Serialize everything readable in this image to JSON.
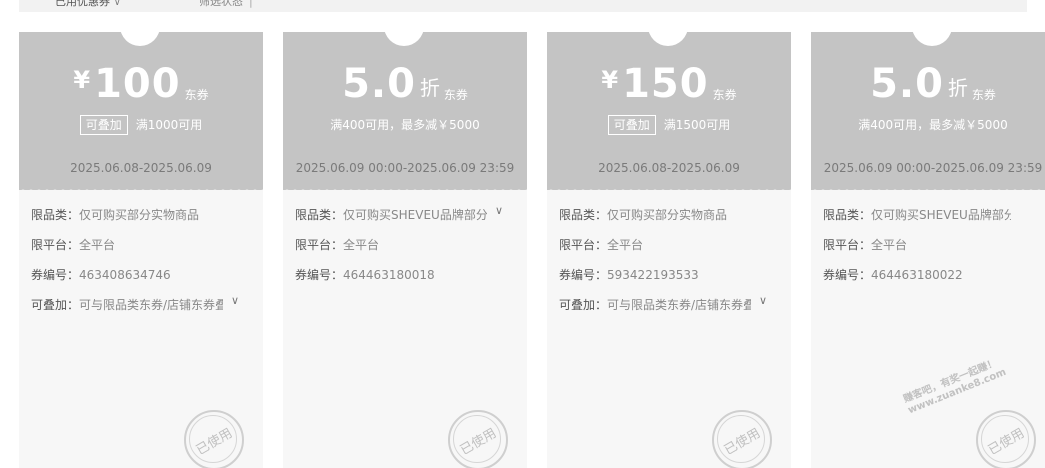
{
  "filters": {
    "coupon_type": "已用优惠券",
    "status": "筛选状态"
  },
  "coupons": [
    {
      "currency": "¥",
      "amount": "100",
      "discount_suffix": "",
      "unit": "东券",
      "stack_badge": "可叠加",
      "condition": "满1000可用",
      "dates": "2025.06.08-2025.06.09",
      "rows": [
        {
          "label": "限品类：",
          "text": "仅可购买部分实物商品"
        },
        {
          "label": "限平台：",
          "text": "全平台"
        },
        {
          "label": "券编号：",
          "text": "463408634746"
        },
        {
          "label": "可叠加：",
          "text": "可与限品类东券/店铺东券叠加"
        }
      ],
      "used": "已使用"
    },
    {
      "currency": "",
      "amount": "5.0",
      "discount_suffix": "折",
      "unit": "东券",
      "stack_badge": "",
      "condition": "满400可用，最多减￥5000",
      "dates": "2025.06.09 00:00-2025.06.09 23:59",
      "rows": [
        {
          "label": "限品类：",
          "text": "仅可购买SHEVEU品牌部分商品"
        },
        {
          "label": "限平台：",
          "text": "全平台"
        },
        {
          "label": "券编号：",
          "text": "464463180018"
        }
      ],
      "used": "已使用"
    },
    {
      "currency": "¥",
      "amount": "150",
      "discount_suffix": "",
      "unit": "东券",
      "stack_badge": "可叠加",
      "condition": "满1500可用",
      "dates": "2025.06.08-2025.06.09",
      "rows": [
        {
          "label": "限品类：",
          "text": "仅可购买部分实物商品"
        },
        {
          "label": "限平台：",
          "text": "全平台"
        },
        {
          "label": "券编号：",
          "text": "593422193533"
        },
        {
          "label": "可叠加：",
          "text": "可与限品类东券/店铺东券叠加"
        }
      ],
      "used": "已使用"
    },
    {
      "currency": "",
      "amount": "5.0",
      "discount_suffix": "折",
      "unit": "东券",
      "stack_badge": "",
      "condition": "满400可用，最多减￥5000",
      "dates": "2025.06.09 00:00-2025.06.09 23:59",
      "rows": [
        {
          "label": "限品类：",
          "text": "仅可购买SHEVEU品牌部分商品"
        },
        {
          "label": "限平台：",
          "text": "全平台"
        },
        {
          "label": "券编号：",
          "text": "464463180022"
        }
      ],
      "used": "已使用"
    }
  ],
  "watermark": {
    "line1": "赚客吧，有奖一起赚！",
    "line2": "www.zuanke8.com"
  },
  "colors": {
    "coupon_head": "#c4c4c4",
    "coupon_body": "#f7f7f7",
    "topbar": "#f2f2f2"
  }
}
